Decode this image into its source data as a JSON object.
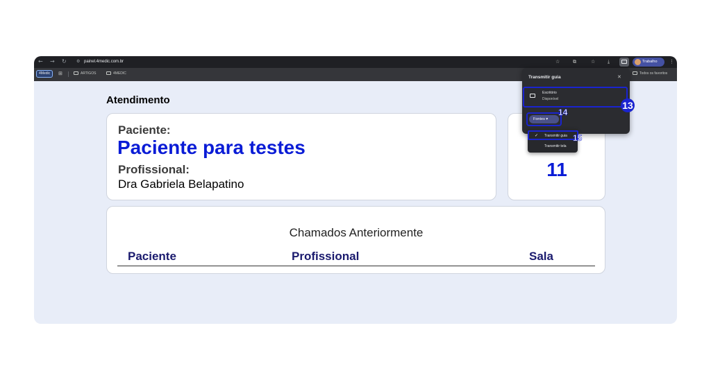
{
  "browser": {
    "url": "painel.4medic.com.br",
    "profile_label": "Trabalho",
    "bookmarks": {
      "badge": "4Medic",
      "items": [
        "ARTIGOS",
        "4MEDIC"
      ],
      "all_favorites": "Todos os favoritos"
    }
  },
  "page": {
    "section_title": "Atendimento",
    "patient_label": "Paciente:",
    "patient_name": "Paciente para testes",
    "professional_label": "Profissional:",
    "professional_name": "Dra Gabriela Belapatino",
    "room_number": "11",
    "history": {
      "title": "Chamados Anteriormente",
      "columns": [
        "Paciente",
        "Profissional",
        "Sala"
      ]
    }
  },
  "cast_popup": {
    "title": "Transmitir guia",
    "device_name": "Escritório",
    "device_status": "Disponível",
    "sources_button": "Fontes",
    "options": [
      "Transmitir guia",
      "Transmitir tela"
    ],
    "annotations": [
      "13",
      "14",
      "15"
    ]
  }
}
